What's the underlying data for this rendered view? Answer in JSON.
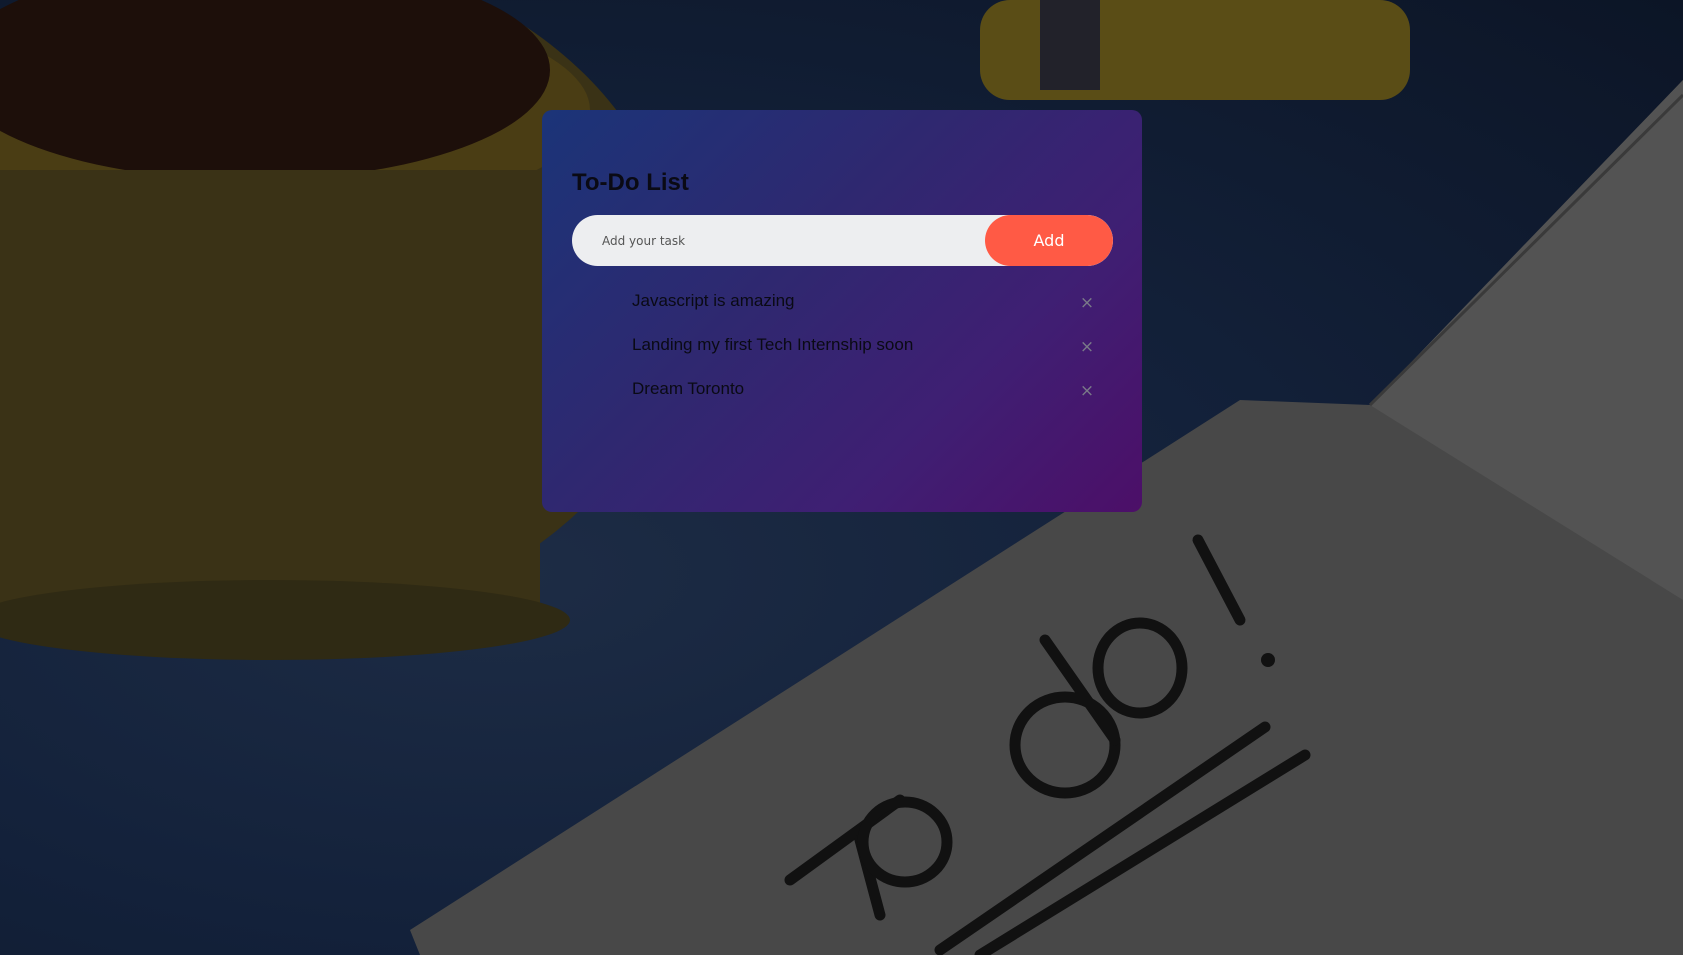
{
  "todo": {
    "title": "To-Do List",
    "input": {
      "value": "",
      "placeholder": "Add your task"
    },
    "add_label": "Add",
    "tasks": [
      {
        "text": "Javascript is amazing",
        "remove_icon": "close-icon"
      },
      {
        "text": "Landing my first Tech Internship soon",
        "remove_icon": "close-icon"
      },
      {
        "text": "Dream Toronto",
        "remove_icon": "close-icon"
      }
    ],
    "remove_glyph": "×"
  },
  "background": {
    "handwritten_note": "To do!"
  },
  "colors": {
    "accent": "#ff5a45",
    "card_gradient_start": "#1b3478",
    "card_gradient_end": "#4c0f68",
    "page_background": "#13213a"
  }
}
